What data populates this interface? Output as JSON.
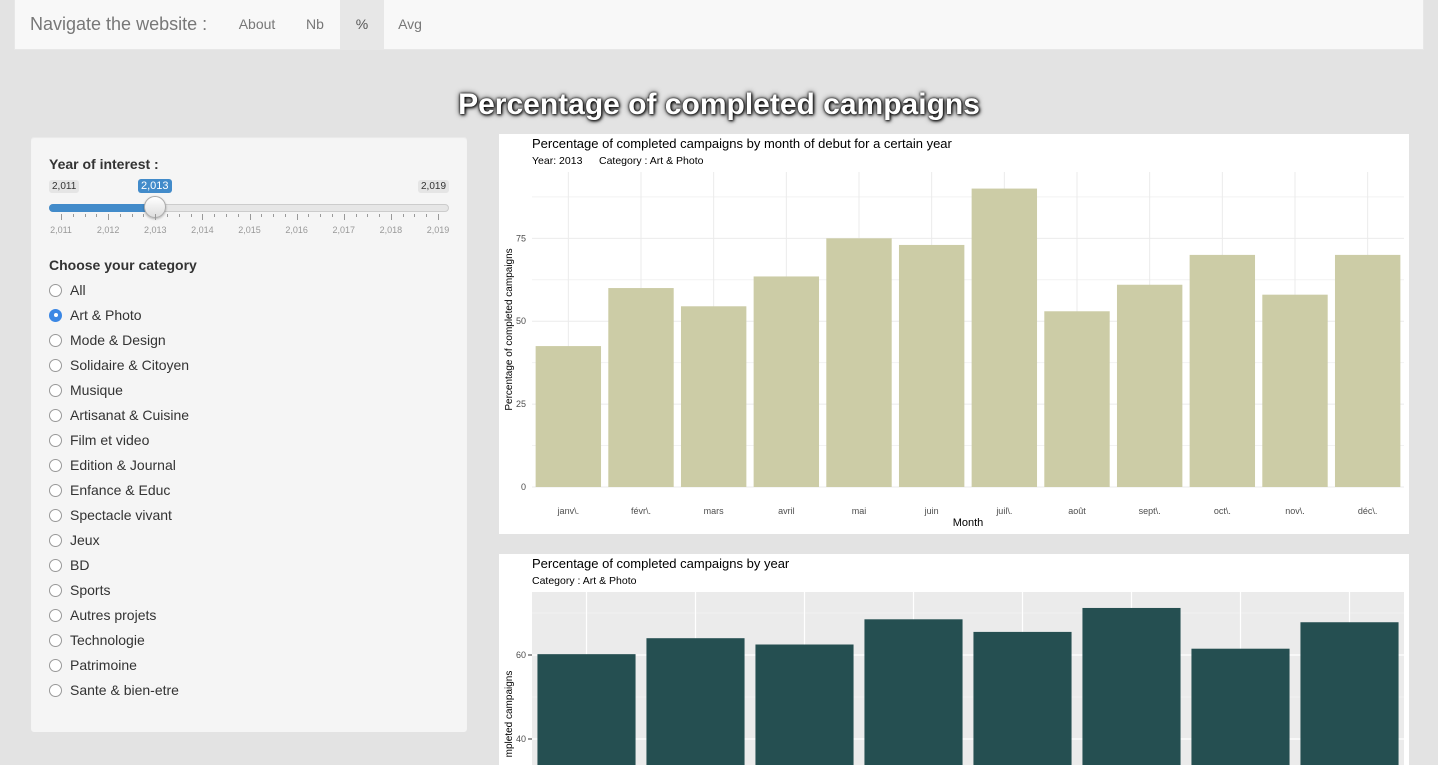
{
  "navbar": {
    "brand": "Navigate the website :",
    "items": [
      {
        "label": "About",
        "active": false
      },
      {
        "label": "Nb",
        "active": false
      },
      {
        "label": "%",
        "active": true
      },
      {
        "label": "Avg",
        "active": false
      }
    ]
  },
  "page_title": "Percentage of completed campaigns",
  "sidebar": {
    "slider": {
      "label": "Year of interest :",
      "min_label": "2,011",
      "max_label": "2,019",
      "value_label": "2,013",
      "min": 2011,
      "max": 2019,
      "value": 2013,
      "tick_labels": [
        "2,011",
        "2,012",
        "2,013",
        "2,014",
        "2,015",
        "2,016",
        "2,017",
        "2,018",
        "2,019"
      ]
    },
    "category_label": "Choose your category",
    "categories": [
      "All",
      "Art & Photo",
      "Mode & Design",
      "Solidaire & Citoyen",
      "Musique",
      "Artisanat & Cuisine",
      "Film et video",
      "Edition & Journal",
      "Enfance & Educ",
      "Spectacle vivant",
      "Jeux",
      "BD",
      "Sports",
      "Autres projets",
      "Technologie",
      "Patrimoine",
      "Sante & bien-etre"
    ],
    "selected_category": "Art & Photo"
  },
  "colors": {
    "accent": "#428bca",
    "month_bar": "#cccca6",
    "year_bar": "#254f51",
    "year_panel_bg": "#ebebeb"
  },
  "chart_data": [
    {
      "type": "bar",
      "title": "Percentage of completed campaigns by month of debut for a certain year",
      "subtitle_year": "Year: 2013",
      "subtitle_category": "Category : Art & Photo",
      "xlabel": "Month",
      "ylabel": "Percentage of completed campaigns",
      "categories": [
        "janv\\.",
        "févr\\.",
        "mars",
        "avril",
        "mai",
        "juin",
        "juil\\.",
        "août",
        "sept\\.",
        "oct\\.",
        "nov\\.",
        "déc\\."
      ],
      "values": [
        42.5,
        60,
        54.5,
        63.5,
        75,
        73,
        90,
        53,
        61,
        70,
        58,
        70
      ],
      "ylim": [
        0,
        95
      ],
      "yticks": [
        0,
        25,
        50,
        75
      ],
      "grid": true
    },
    {
      "type": "bar",
      "title": "Percentage of completed campaigns by year",
      "subtitle_category": "Category : Art & Photo",
      "ylabel": "Percentage of completed campaigns",
      "ylabel_visible": "mpleted campaigns",
      "values": [
        60.2,
        64,
        62.5,
        68.5,
        65.5,
        71.2,
        61.5,
        67.8
      ],
      "yticks": [
        40,
        60
      ],
      "grid": true
    }
  ]
}
